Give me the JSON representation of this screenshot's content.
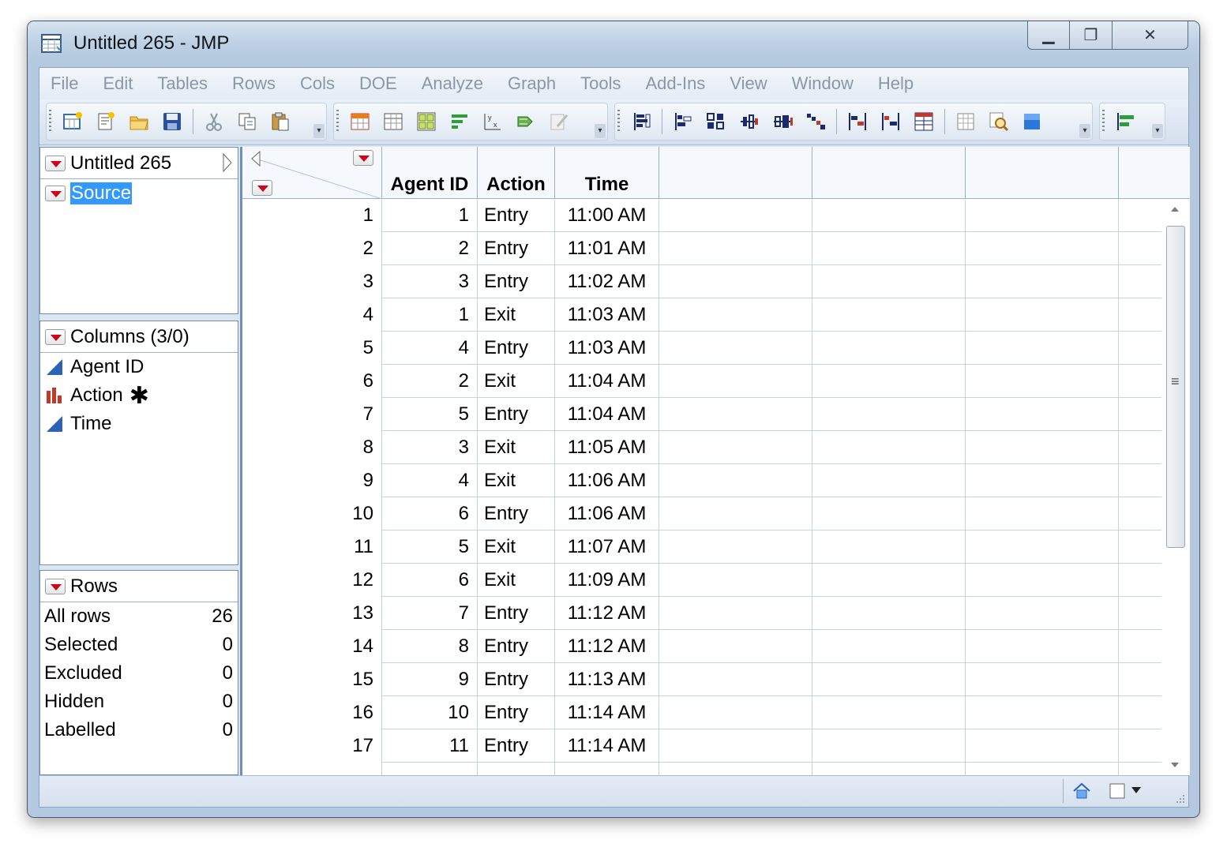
{
  "window": {
    "title": "Untitled 265 - JMP"
  },
  "menu": [
    "File",
    "Edit",
    "Tables",
    "Rows",
    "Cols",
    "DOE",
    "Analyze",
    "Graph",
    "Tools",
    "Add-Ins",
    "View",
    "Window",
    "Help"
  ],
  "toolbar": {
    "icons": [
      "new-data-table-icon",
      "new-script-icon",
      "open-icon",
      "save-icon",
      "cut-icon",
      "copy-icon",
      "paste-icon",
      "data-grid-icon",
      "table-icon",
      "subset-icon",
      "sort-icon",
      "formula-icon",
      "run-script-icon",
      "edit-icon",
      "distribution-icon",
      "fit-y-by-x-icon",
      "fit-model-icon",
      "multivariate-icon",
      "graph-builder-icon",
      "scatterplot-icon",
      "bar-chart-icon",
      "chart-icon",
      "table-summary-icon",
      "overlay-icon",
      "search-icon",
      "color-icon",
      "align-left-icon"
    ]
  },
  "table_panel": {
    "title": "Untitled 265",
    "items": [
      "Source"
    ]
  },
  "columns_panel": {
    "title": "Columns (3/0)",
    "items": [
      {
        "name": "Agent ID",
        "icon": "continuous-icon"
      },
      {
        "name": "Action",
        "icon": "nominal-icon",
        "marker": "✱"
      },
      {
        "name": "Time",
        "icon": "continuous-icon"
      }
    ]
  },
  "rows_panel": {
    "title": "Rows",
    "items": [
      {
        "label": "All rows",
        "value": "26"
      },
      {
        "label": "Selected",
        "value": "0"
      },
      {
        "label": "Excluded",
        "value": "0"
      },
      {
        "label": "Hidden",
        "value": "0"
      },
      {
        "label": "Labelled",
        "value": "0"
      }
    ]
  },
  "grid": {
    "columns": [
      "Agent ID",
      "Action",
      "Time"
    ],
    "rows": [
      [
        "1",
        "1",
        "Entry",
        "11:00 AM"
      ],
      [
        "2",
        "2",
        "Entry",
        "11:01 AM"
      ],
      [
        "3",
        "3",
        "Entry",
        "11:02 AM"
      ],
      [
        "4",
        "1",
        "Exit",
        "11:03 AM"
      ],
      [
        "5",
        "4",
        "Entry",
        "11:03 AM"
      ],
      [
        "6",
        "2",
        "Exit",
        "11:04 AM"
      ],
      [
        "7",
        "5",
        "Entry",
        "11:04 AM"
      ],
      [
        "8",
        "3",
        "Exit",
        "11:05 AM"
      ],
      [
        "9",
        "4",
        "Exit",
        "11:06 AM"
      ],
      [
        "10",
        "6",
        "Entry",
        "11:06 AM"
      ],
      [
        "11",
        "5",
        "Exit",
        "11:07 AM"
      ],
      [
        "12",
        "6",
        "Exit",
        "11:09 AM"
      ],
      [
        "13",
        "7",
        "Entry",
        "11:12 AM"
      ],
      [
        "14",
        "8",
        "Entry",
        "11:12 AM"
      ],
      [
        "15",
        "9",
        "Entry",
        "11:13 AM"
      ],
      [
        "16",
        "10",
        "Entry",
        "11:14 AM"
      ],
      [
        "17",
        "11",
        "Entry",
        "11:14 AM"
      ]
    ]
  },
  "colors": {
    "accent": "#3399ff",
    "red_triangle": "#d0021b",
    "frame": "#b4c9df"
  }
}
